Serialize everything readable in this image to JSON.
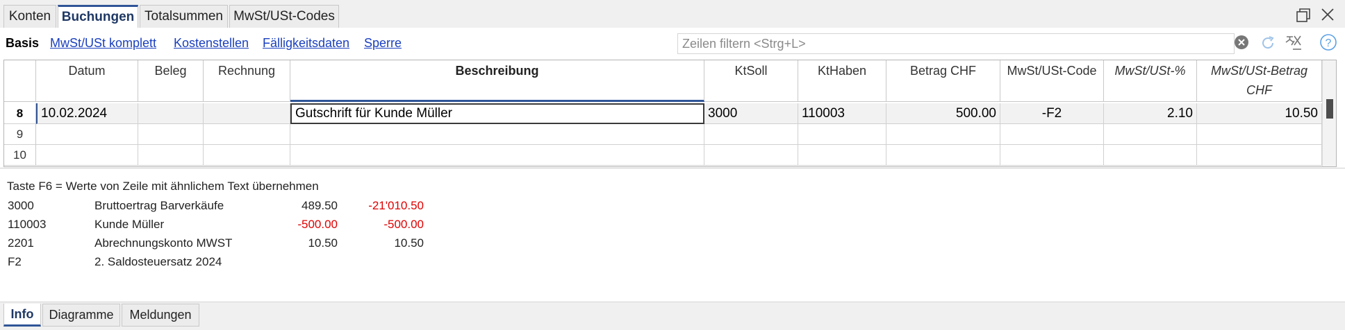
{
  "tabs": {
    "konten": "Konten",
    "buchungen": "Buchungen",
    "totalsummen": "Totalsummen",
    "mwst": "MwSt/USt-Codes"
  },
  "subnav": {
    "basis": "Basis",
    "links": [
      "MwSt/USt komplett",
      "Kostenstellen",
      "Fälligkeitsdaten",
      "Sperre"
    ]
  },
  "filter": {
    "placeholder": "Zeilen filtern <Strg+L>"
  },
  "columns": [
    "Datum",
    "Beleg",
    "Rechnung",
    "Beschreibung",
    "KtSoll",
    "KtHaben",
    "Betrag CHF",
    "MwSt/USt-Code",
    "MwSt/USt-%",
    "MwSt/USt-Betrag CHF"
  ],
  "rows": [
    {
      "num": "8",
      "datum": "10.02.2024",
      "beleg": "",
      "rechnung": "",
      "beschreibung": "Gutschrift für Kunde Müller",
      "ktsoll": "3000",
      "kthaben": "110003",
      "betrag": "500.00",
      "code": "-F2",
      "pct": "2.10",
      "mwstbetrag": "10.50"
    },
    {
      "num": "9"
    },
    {
      "num": "10"
    }
  ],
  "info": {
    "hint": "Taste F6 = Werte von Zeile mit ähnlichem Text übernehmen",
    "lines": [
      {
        "code": "3000",
        "name": "Bruttoertrag Barverkäufe",
        "amount": "489.50",
        "balance": "-21'010.50"
      },
      {
        "code": "110003",
        "name": "Kunde Müller",
        "amount": "-500.00",
        "balance": "-500.00"
      },
      {
        "code": "2201",
        "name": "Abrechnungskonto MWST",
        "amount": "10.50",
        "balance": "10.50"
      },
      {
        "code": "F2",
        "name": "2. Saldosteuersatz 2024",
        "amount": "",
        "balance": ""
      }
    ]
  },
  "bottom_tabs": [
    "Info",
    "Diagramme",
    "Meldungen"
  ],
  "icons": {
    "restore": "restore-window-icon",
    "close": "close-icon",
    "clear": "clear-filter-icon",
    "refresh": "refresh-icon",
    "filter_off": "filter-off-icon",
    "help": "help-icon"
  },
  "colors": {
    "accent": "#2f5597",
    "link": "#1a3fbf",
    "negative": "#e00000"
  }
}
